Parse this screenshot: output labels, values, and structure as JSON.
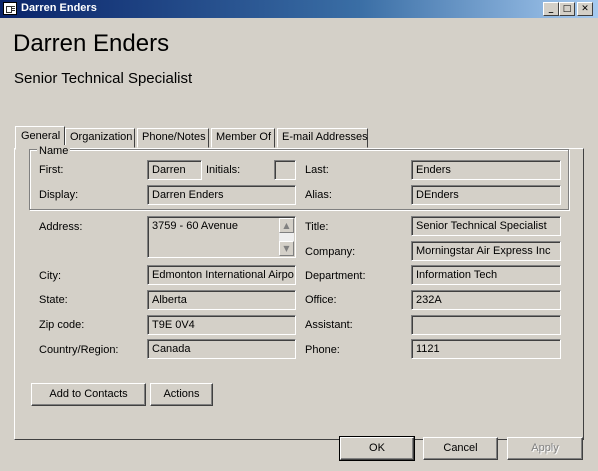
{
  "window": {
    "title": "Darren Enders",
    "minimize_glyph": "_",
    "maximize_glyph": "□",
    "close_glyph": "✕"
  },
  "header": {
    "name": "Darren Enders",
    "job_title": "Senior Technical Specialist"
  },
  "tabs": [
    {
      "label": "General"
    },
    {
      "label": "Organization"
    },
    {
      "label": "Phone/Notes"
    },
    {
      "label": "Member Of"
    },
    {
      "label": "E-mail Addresses"
    }
  ],
  "active_tab": "General",
  "name_group": {
    "label": "Name",
    "first_label": "First:",
    "first_value": "Darren",
    "initials_label": "Initials:",
    "initials_value": "",
    "last_label": "Last:",
    "last_value": "Enders",
    "display_label": "Display:",
    "display_value": "Darren Enders",
    "alias_label": "Alias:",
    "alias_value": "DEnders"
  },
  "address": {
    "address_label": "Address:",
    "address_value": "3759 - 60 Avenue",
    "city_label": "City:",
    "city_value": "Edmonton International Airpo",
    "state_label": "State:",
    "state_value": "Alberta",
    "zip_label": "Zip code:",
    "zip_value": "T9E 0V4",
    "country_label": "Country/Region:",
    "country_value": "Canada"
  },
  "org": {
    "title_label": "Title:",
    "title_value": "Senior Technical Specialist",
    "company_label": "Company:",
    "company_value": "Morningstar Air Express Inc",
    "department_label": "Department:",
    "department_value": "Information Tech",
    "office_label": "Office:",
    "office_value": "232A",
    "assistant_label": "Assistant:",
    "assistant_value": "",
    "phone_label": "Phone:",
    "phone_value": "1121"
  },
  "buttons": {
    "add_to_contacts": "Add to Contacts",
    "actions": "Actions",
    "ok": "OK",
    "cancel": "Cancel",
    "apply": "Apply"
  },
  "icons": {
    "window_icon": "contact-card-icon",
    "scroll_up": "▲",
    "scroll_down": "▼"
  },
  "colors": {
    "face": "#d4d0c8",
    "titlebar_start": "#0a246a",
    "titlebar_end": "#a6caf0"
  }
}
